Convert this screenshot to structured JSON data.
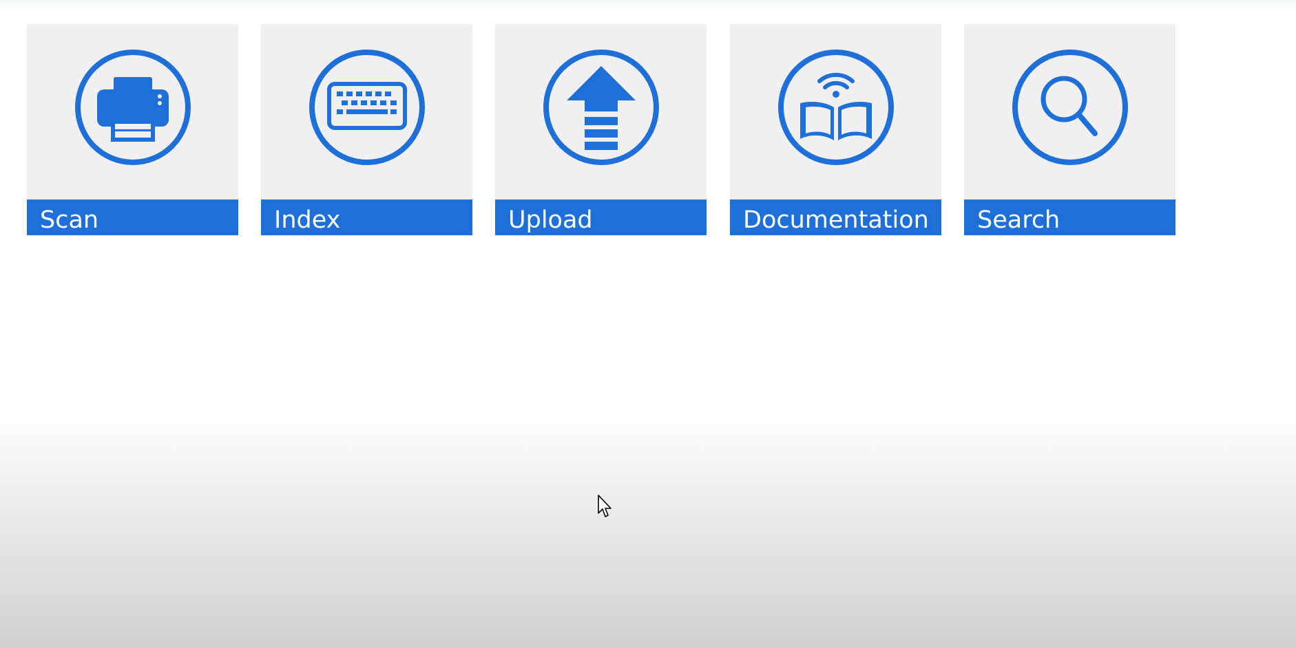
{
  "theme": {
    "accent": "#1f6fd8",
    "tile_background": "#f0f0f2",
    "label_text": "#ffffff"
  },
  "tiles": [
    {
      "label": "Scan",
      "icon": "printer-icon"
    },
    {
      "label": "Index",
      "icon": "keyboard-icon"
    },
    {
      "label": "Upload",
      "icon": "upload-arrow-icon"
    },
    {
      "label": "Documentation",
      "icon": "wireless-book-icon"
    },
    {
      "label": "Search",
      "icon": "magnifier-icon"
    }
  ]
}
